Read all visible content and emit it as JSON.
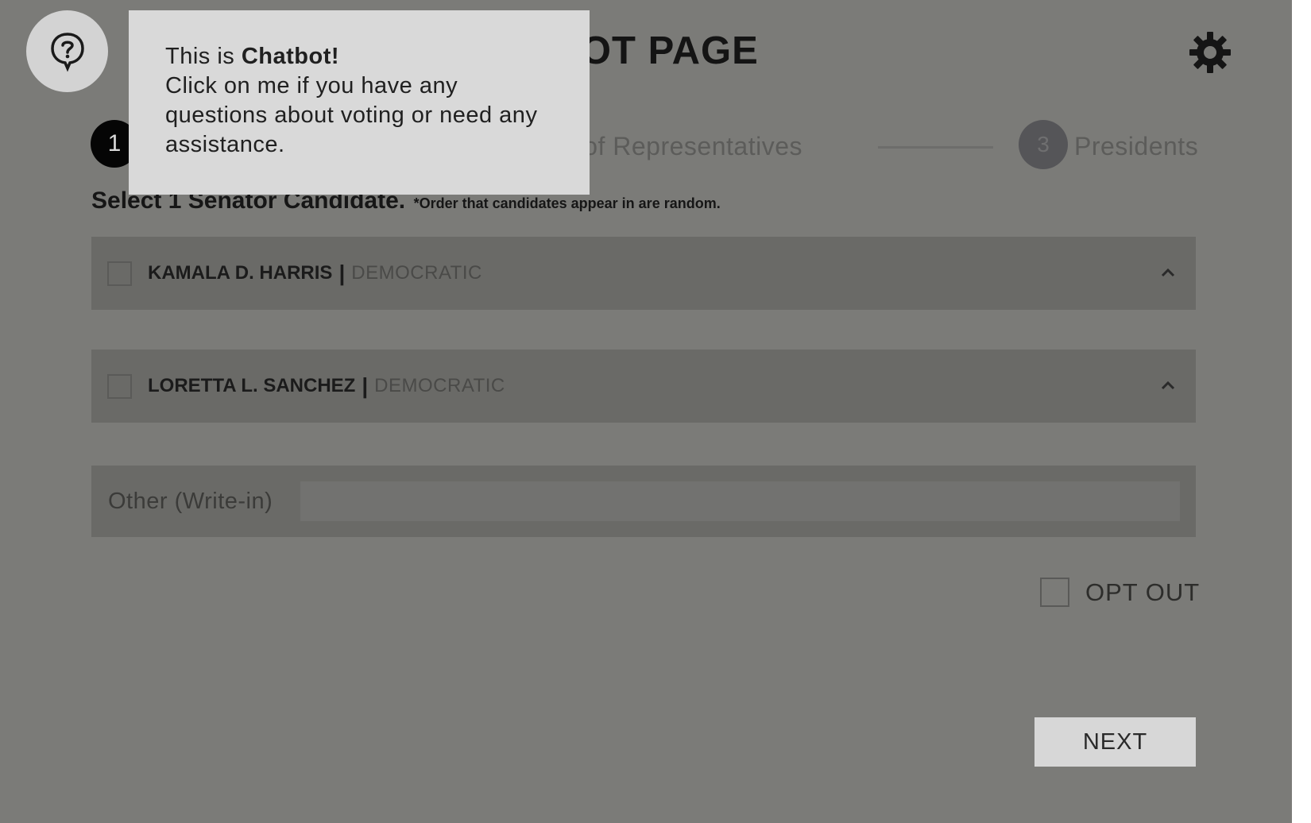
{
  "header": {
    "title": "LOT PAGE"
  },
  "stepper": {
    "step1_number": "1",
    "step2_label": "se of Representatives",
    "step3_number": "3",
    "step3_label": "Presidents"
  },
  "instruction": {
    "main": "Select 1 Senator Candidate.",
    "note": "*Order that candidates appear in are random."
  },
  "candidates": [
    {
      "name": "KAMALA D. HARRIS",
      "separator": "|",
      "party": "DEMOCRATIC"
    },
    {
      "name": "LORETTA L. SANCHEZ",
      "separator": "|",
      "party": "DEMOCRATIC"
    }
  ],
  "writein": {
    "label": "Other (Write-in)",
    "value": ""
  },
  "optout": {
    "label": "OPT OUT"
  },
  "next": {
    "label": "NEXT"
  },
  "chatbot": {
    "intro_prefix": "This is ",
    "name": "Chatbot!",
    "body": "Click on me if you have any questions about voting or need any assistance."
  },
  "icons": {
    "chat": "help-chat-icon",
    "settings": "gear-icon",
    "expand": "chevron-up-icon"
  },
  "colors": {
    "overlay_bg": "#7b7b78",
    "tooltip_bg": "#d9d9d9",
    "next_bg": "#d7d7d7"
  }
}
